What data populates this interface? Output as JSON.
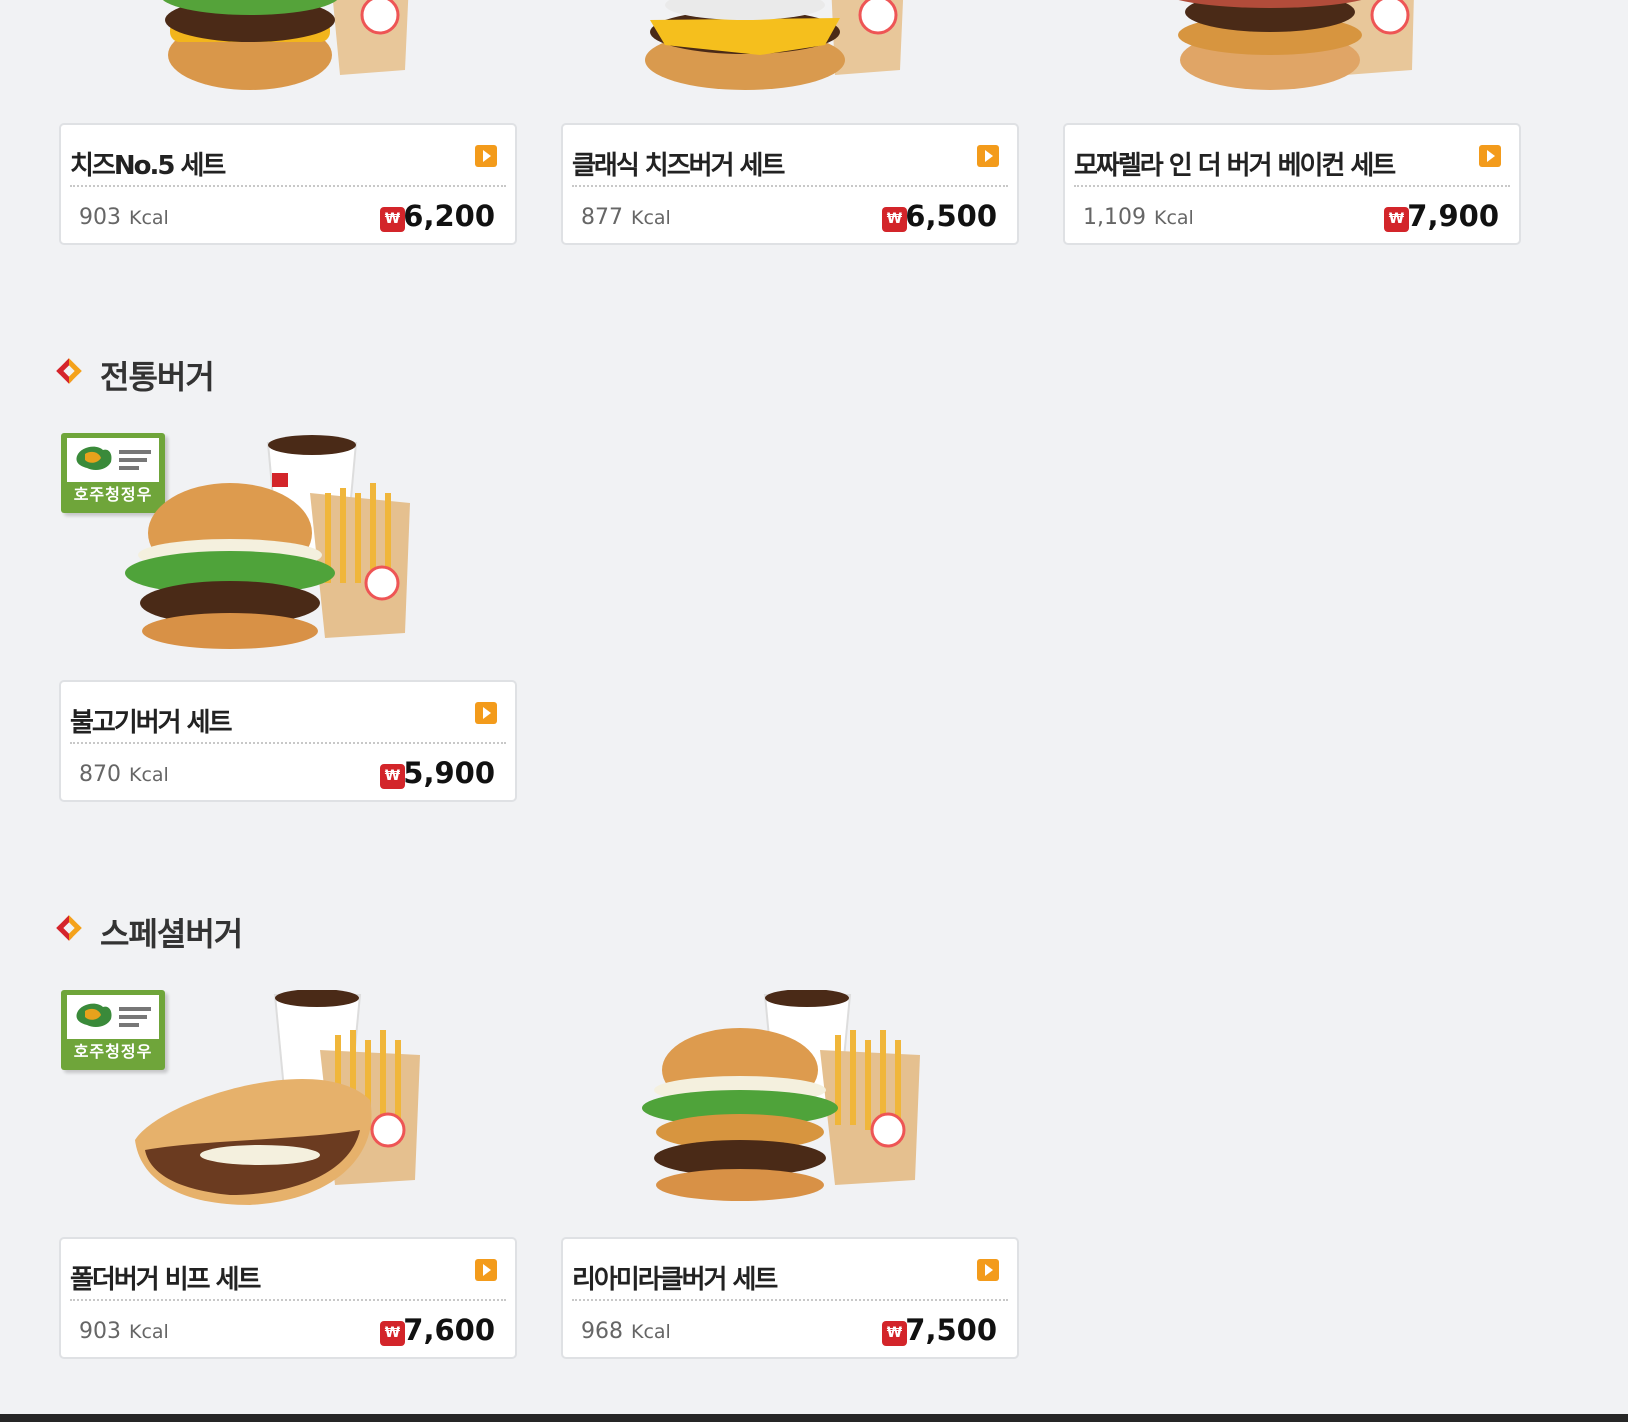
{
  "sections": [
    {
      "title": "전통버거"
    },
    {
      "title": "스페셜버거"
    }
  ],
  "products": [
    {
      "name": "치즈No.5 세트",
      "kcal": "903",
      "kcal_unit": "Kcal",
      "price": "6,200"
    },
    {
      "name": "클래식 치즈버거 세트",
      "kcal": "877",
      "kcal_unit": "Kcal",
      "price": "6,500"
    },
    {
      "name": "모짜렐라 인 더 버거 베이컨 세트",
      "kcal": "1,109",
      "kcal_unit": "Kcal",
      "price": "7,900"
    },
    {
      "name": "불고기버거 세트",
      "kcal": "870",
      "kcal_unit": "Kcal",
      "price": "5,900"
    },
    {
      "name": "폴더버거 비프 세트",
      "kcal": "903",
      "kcal_unit": "Kcal",
      "price": "7,600"
    },
    {
      "name": "리아미라클버거 세트",
      "kcal": "968",
      "kcal_unit": "Kcal",
      "price": "7,500"
    }
  ],
  "badge": {
    "label": "호주청정우"
  },
  "currency": {
    "symbol": "₩",
    "icon": "won-icon",
    "color": "#d3252a"
  },
  "colors": {
    "accent_orange": "#f39b1b",
    "accent_red": "#d3252a",
    "badge_green": "#6fa53a"
  }
}
